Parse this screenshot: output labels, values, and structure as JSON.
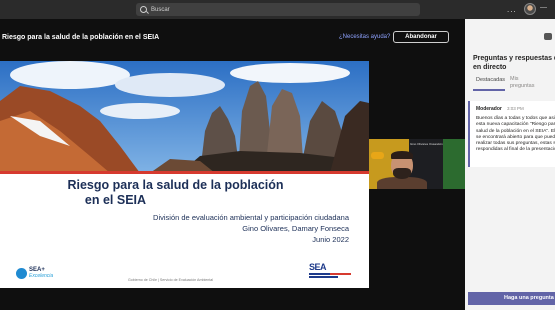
{
  "search": {
    "placeholder": "Buscar"
  },
  "top_icons": {
    "more": "...",
    "minimize": "—",
    "restore": "▢",
    "close": "✕"
  },
  "meeting": {
    "title": "Riesgo para la salud de la población en el SEIA",
    "help_link": "¿Necesitas ayuda?",
    "leave_button": "Abandonar"
  },
  "slide": {
    "title_line1": "Riesgo para la salud de la población",
    "title_line2": "en el SEIA",
    "subtitle_line1": "División de evaluación ambiental y participación ciudadana",
    "subtitle_line2": "Gino Olivares, Damary Fonseca",
    "subtitle_line3": "Junio 2022",
    "footer": "Gobierno de Chile | Servicio de Evaluación Ambiental",
    "logo_left_main": "SEA+",
    "logo_left_sub": "Excelencia",
    "logo_right": "SEA"
  },
  "camera": {
    "name_label": "Gino Olivares Ossandón"
  },
  "qa_panel": {
    "title": "Preguntas y respuestas del evento en directo",
    "tabs": [
      "Destacadas",
      "Mis preguntas"
    ],
    "message": {
      "author": "Moderador",
      "time": "3:03 PM",
      "text": "Buenos días a todas y todos que asisten a esta nueva capacitación \"Riesgo para la salud de la población en el SEIA\". El chat se encontrará abierto para que puedan realizar todas sus preguntas, estas serán respondidas al final de la presentación."
    },
    "ask_button": "Haga una pregunta"
  }
}
